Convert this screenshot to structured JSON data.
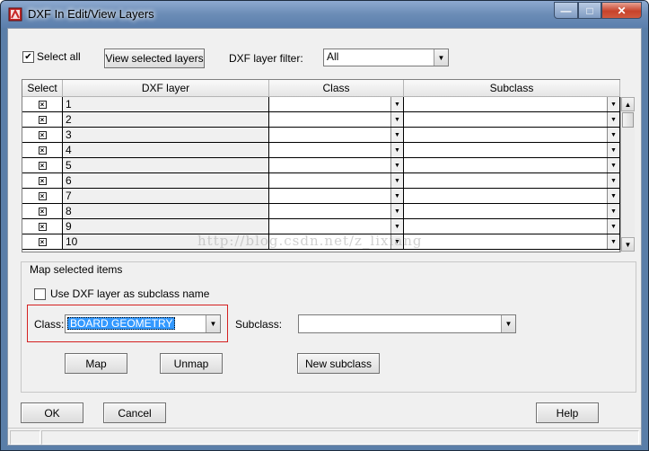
{
  "window": {
    "title": "DXF In Edit/View Layers"
  },
  "top": {
    "select_all_label": "Select all",
    "select_all_checked": true,
    "view_selected_button": "View selected layers",
    "filter_label": "DXF layer filter:",
    "filter_value": "All"
  },
  "grid": {
    "headers": {
      "select": "Select",
      "layer": "DXF layer",
      "class": "Class",
      "subclass": "Subclass"
    },
    "rows": [
      {
        "layer": "1"
      },
      {
        "layer": "2"
      },
      {
        "layer": "3"
      },
      {
        "layer": "4"
      },
      {
        "layer": "5"
      },
      {
        "layer": "6"
      },
      {
        "layer": "7"
      },
      {
        "layer": "8"
      },
      {
        "layer": "9"
      },
      {
        "layer": "10"
      }
    ]
  },
  "map_group": {
    "legend": "Map selected items",
    "use_dxf_label": "Use DXF layer as subclass name",
    "use_dxf_checked": false,
    "class_label": "Class:",
    "class_value": "BOARD GEOMETRY",
    "subclass_label": "Subclass:",
    "subclass_value": "",
    "map_button": "Map",
    "unmap_button": "Unmap",
    "new_subclass_button": "New subclass"
  },
  "bottom": {
    "ok_button": "OK",
    "cancel_button": "Cancel",
    "help_button": "Help"
  },
  "watermark": "http://blog.csdn.net/z_lixiang",
  "colors": {
    "highlight": "#3399ff",
    "emphasis_border": "#d42020"
  }
}
